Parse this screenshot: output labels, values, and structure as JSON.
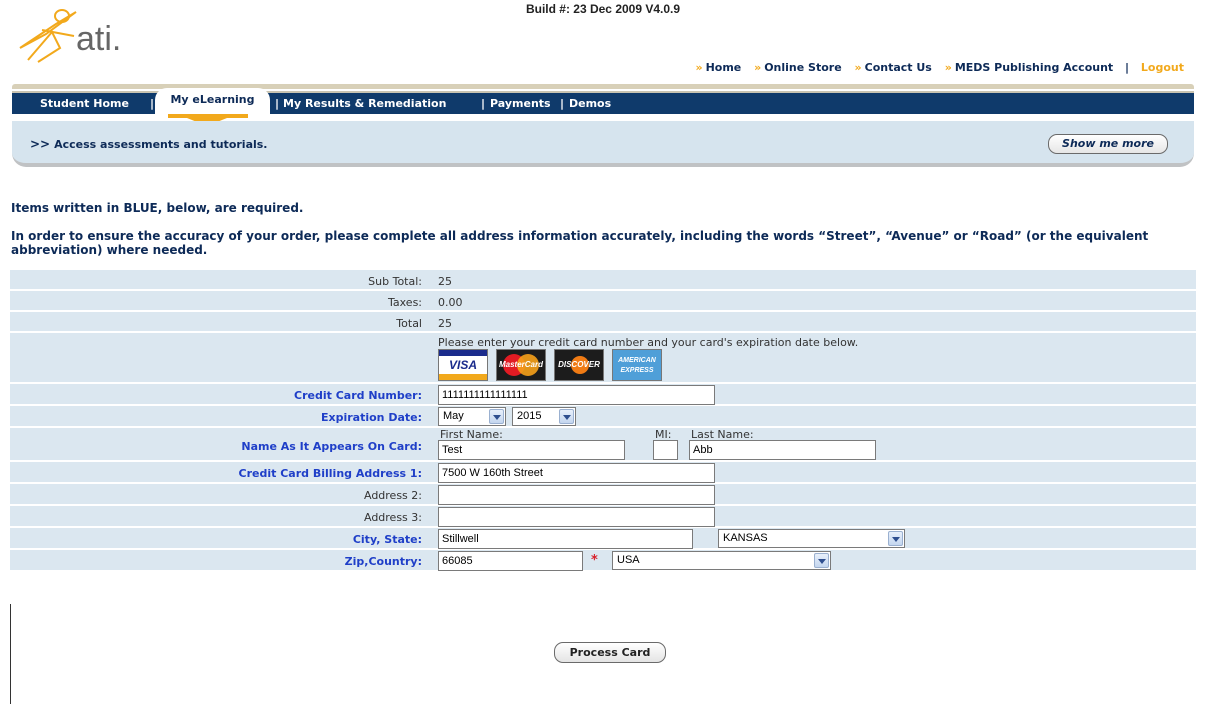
{
  "build": "Build #: 23 Dec 2009 V4.0.9",
  "logo_text": "ati.",
  "top_links": [
    {
      "label": "Home"
    },
    {
      "label": "Online Store"
    },
    {
      "label": "Contact Us"
    },
    {
      "label": "MEDS Publishing Account"
    }
  ],
  "logout_label": "Logout",
  "nav": {
    "items": [
      "Student Home",
      "My eLearning",
      "My Results & Remediation",
      "Payments",
      "Demos"
    ],
    "active_index": 1
  },
  "banner": {
    "arrow": ">>",
    "text": "Access assessments and tutorials.",
    "show_more": "Show me more"
  },
  "notes": {
    "required": "Items written in BLUE, below, are required.",
    "accuracy": "In order to ensure the accuracy of your order, please complete all address information accurately, including the words “Street”, “Avenue” or “Road” (or the equivalent abbreviation) where needed."
  },
  "summary": {
    "subtotal_label": "Sub Total:",
    "subtotal": "25",
    "taxes_label": "Taxes:",
    "taxes": "0.00",
    "total_label": "Total",
    "total": "25"
  },
  "card_prompt": "Please enter your credit card number and your card's expiration date below.",
  "card_logos": [
    "VISA",
    "MasterCard",
    "DISCOVER",
    "AMERICAN EXPRESS"
  ],
  "form": {
    "cc_number_label": "Credit Card Number:",
    "cc_number": "1111111111111111",
    "exp_label": "Expiration Date:",
    "exp_month": "May",
    "exp_year": "2015",
    "name_label": "Name As It Appears On Card:",
    "first_label": "First Name:",
    "mi_label": "MI:",
    "last_label": "Last Name:",
    "first": "Test",
    "mi": "",
    "last": "Abb",
    "addr1_label": "Credit Card Billing Address 1:",
    "addr1": "7500 W 160th Street",
    "addr2_label": "Address 2:",
    "addr2": "",
    "addr3_label": "Address 3:",
    "addr3": "",
    "city_label": "City, State:",
    "city": "Stillwell",
    "state": "KANSAS",
    "zip_label": "Zip,Country:",
    "zip": "66085",
    "required_star": "*",
    "country": "USA"
  },
  "process_button": "Process Card",
  "colors": {
    "navy": "#0f3a6b",
    "accent_orange": "#f2a91c",
    "required_blue": "#1f3fc8",
    "row_bg": "#dbe7f0"
  }
}
